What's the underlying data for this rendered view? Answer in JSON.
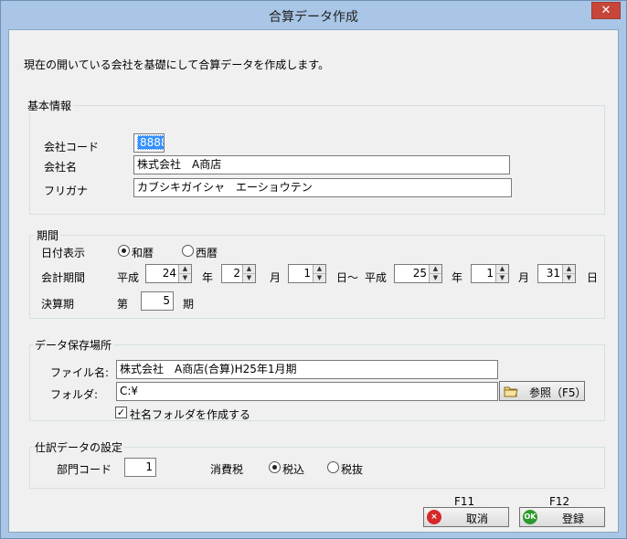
{
  "window": {
    "title": "合算データ作成",
    "close_glyph": "✕"
  },
  "description": "現在の開いている会社を基礎にして合算データを作成します。",
  "basic_info": {
    "group_title": "基本情報",
    "company_code_label": "会社コード",
    "company_code_value": "8888",
    "company_name_label": "会社名",
    "company_name_value": "株式会社　A商店",
    "furigana_label": "フリガナ",
    "furigana_value": "カブシキガイシャ　エーショウテン"
  },
  "period": {
    "group_title": "期間",
    "date_display_label": "日付表示",
    "radio_wareki": "和暦",
    "radio_seireki": "西暦",
    "selected": "wareki",
    "fiscal_period_label": "会計期間",
    "era_start": "平成",
    "start_year": "24",
    "year_unit": "年",
    "start_month": "2",
    "month_unit": "月",
    "start_day": "1",
    "day_range": "日～",
    "era_end": "平成",
    "end_year": "25",
    "end_month": "1",
    "end_day": "31",
    "day_unit": "日",
    "settlement_label": "決算期",
    "settlement_prefix": "第",
    "settlement_value": "5",
    "settlement_suffix": "期"
  },
  "save_location": {
    "group_title": "データ保存場所",
    "filename_label": "ファイル名:",
    "filename_value": "株式会社　A商店(合算)H25年1月期",
    "folder_label": "フォルダ:",
    "folder_value": "C:¥",
    "browse_label": "参照（F5）",
    "create_folder_label": "社名フォルダを作成する",
    "create_folder_checked": true
  },
  "journal": {
    "group_title": "仕訳データの設定",
    "dept_code_label": "部門コード",
    "dept_code_value": "1",
    "tax_label": "消費税",
    "radio_included": "税込",
    "radio_excluded": "税抜",
    "selected": "included"
  },
  "footer": {
    "cancel_key": "F11",
    "cancel_label": "取消",
    "cancel_icon": "×",
    "register_key": "F12",
    "register_label": "登録",
    "register_icon": "OK"
  }
}
